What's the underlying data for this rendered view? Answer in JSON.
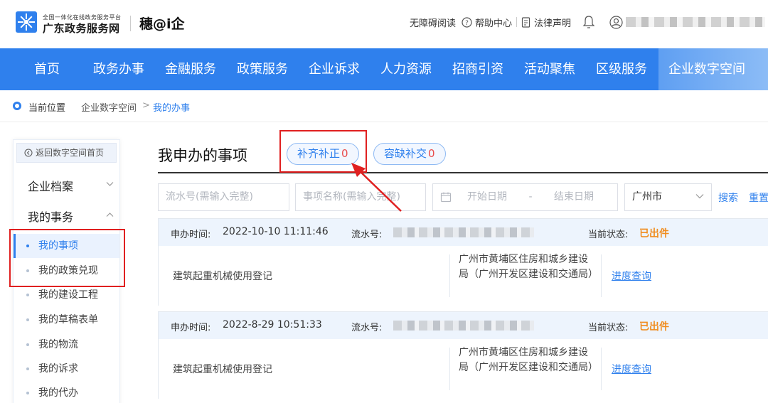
{
  "header": {
    "logo_small": "全国一体化在线政务服务平台",
    "logo_big": "广东政务服务网",
    "brand2": "穗@i企",
    "links": [
      {
        "label": "无障碍阅读",
        "icon": ""
      },
      {
        "label": "帮助中心",
        "icon": "help-circle-icon"
      },
      {
        "label": "法律声明",
        "icon": "document-icon"
      }
    ],
    "bell_icon": "bell-icon",
    "user_icon": "user-icon"
  },
  "nav": {
    "items": [
      "首页",
      "政务办事",
      "金融服务",
      "政策服务",
      "企业诉求",
      "人力资源",
      "招商引资",
      "活动聚焦",
      "区级服务",
      "企业数字空间"
    ],
    "active_index": 9,
    "bg_color": "#2f80ed"
  },
  "breadcrumb": {
    "prefix": "当前位置",
    "level1": "企业数字空间",
    "separator": ">",
    "current": "我的办事"
  },
  "sidebar": {
    "back_label": "返回数字空间首页",
    "groups": [
      {
        "label": "企业档案"
      },
      {
        "label": "我的事务"
      }
    ],
    "items": [
      {
        "label": "我的事项",
        "active": true
      },
      {
        "label": "我的政策兑现",
        "active": false
      },
      {
        "label": "我的建设工程",
        "active": false
      },
      {
        "label": "我的草稿表单",
        "active": false
      },
      {
        "label": "我的物流",
        "active": false
      },
      {
        "label": "我的诉求",
        "active": false
      },
      {
        "label": "我的代办",
        "active": false
      }
    ]
  },
  "main": {
    "title": "我申办的事项",
    "tabs": [
      {
        "label": "补齐补正",
        "count": "0"
      },
      {
        "label": "容缺补交",
        "count": "0"
      }
    ],
    "filters": {
      "serial_placeholder": "流水号(需输入完整)",
      "name_placeholder": "事项名称(需输入完整)",
      "start_date": "开始日期",
      "date_sep": "-",
      "end_date": "结束日期",
      "city": "广州市",
      "search": "搜索",
      "reset": "重置"
    },
    "records": [
      {
        "time_label": "申办时间:",
        "time": "2022-10-10 11:11:46",
        "serial_label": "流水号:",
        "status_label": "当前状态:",
        "status": "已出件",
        "item": "建筑起重机械使用登记",
        "dept": "广州市黄埔区住房和城乡建设局（广州开发区建设和交通局）",
        "action": "进度查询"
      },
      {
        "time_label": "申办时间:",
        "time": "2022-8-29 10:51:33",
        "serial_label": "流水号:",
        "status_label": "当前状态:",
        "status": "已出件",
        "item": "建筑起重机械使用登记",
        "dept": "广州市黄埔区住房和城乡建设局（广州开发区建设和交通局）",
        "action": "进度查询"
      }
    ]
  },
  "colors": {
    "accent": "#2f80ed",
    "status": "#f08c1e",
    "count": "#e94b4b",
    "annotation": "#e02020"
  }
}
